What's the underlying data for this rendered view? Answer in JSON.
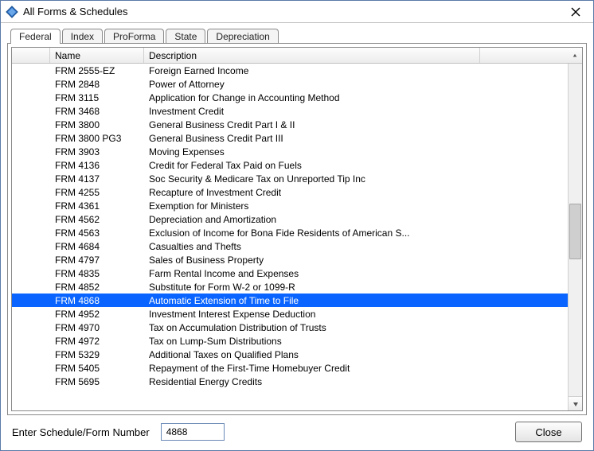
{
  "window": {
    "title": "All Forms & Schedules"
  },
  "tabs": [
    {
      "label": "Federal",
      "active": true
    },
    {
      "label": "Index",
      "active": false
    },
    {
      "label": "ProForma",
      "active": false
    },
    {
      "label": "State",
      "active": false
    },
    {
      "label": "Depreciation",
      "active": false
    }
  ],
  "columns": {
    "name": "Name",
    "description": "Description"
  },
  "rows": [
    {
      "name": "FRM 2555-EZ",
      "description": "Foreign Earned Income",
      "selected": false
    },
    {
      "name": "FRM 2848",
      "description": "Power of Attorney",
      "selected": false
    },
    {
      "name": "FRM 3115",
      "description": "Application for Change in Accounting Method",
      "selected": false
    },
    {
      "name": "FRM 3468",
      "description": "Investment Credit",
      "selected": false
    },
    {
      "name": "FRM 3800",
      "description": "General Business Credit Part I & II",
      "selected": false
    },
    {
      "name": "FRM 3800 PG3",
      "description": "General Business Credit Part III",
      "selected": false
    },
    {
      "name": "FRM 3903",
      "description": "Moving Expenses",
      "selected": false
    },
    {
      "name": "FRM 4136",
      "description": "Credit for Federal Tax Paid on Fuels",
      "selected": false
    },
    {
      "name": "FRM 4137",
      "description": "Soc Security & Medicare Tax on Unreported Tip Inc",
      "selected": false
    },
    {
      "name": "FRM 4255",
      "description": "Recapture of Investment Credit",
      "selected": false
    },
    {
      "name": "FRM 4361",
      "description": "Exemption for Ministers",
      "selected": false
    },
    {
      "name": "FRM 4562",
      "description": "Depreciation and Amortization",
      "selected": false
    },
    {
      "name": "FRM 4563",
      "description": "Exclusion of Income for Bona Fide Residents of American S...",
      "selected": false
    },
    {
      "name": "FRM 4684",
      "description": "Casualties and Thefts",
      "selected": false
    },
    {
      "name": "FRM 4797",
      "description": "Sales of Business Property",
      "selected": false
    },
    {
      "name": "FRM 4835",
      "description": "Farm Rental Income and Expenses",
      "selected": false
    },
    {
      "name": "FRM 4852",
      "description": "Substitute for Form W-2 or 1099-R",
      "selected": false
    },
    {
      "name": "FRM 4868",
      "description": "Automatic Extension of Time to File",
      "selected": true
    },
    {
      "name": "FRM 4952",
      "description": "Investment Interest Expense Deduction",
      "selected": false
    },
    {
      "name": "FRM 4970",
      "description": "Tax on Accumulation Distribution of Trusts",
      "selected": false
    },
    {
      "name": "FRM 4972",
      "description": "Tax on Lump-Sum Distributions",
      "selected": false
    },
    {
      "name": "FRM 5329",
      "description": "Additional Taxes on Qualified Plans",
      "selected": false
    },
    {
      "name": "FRM 5405",
      "description": "Repayment of the First-Time Homebuyer Credit",
      "selected": false
    },
    {
      "name": "FRM 5695",
      "description": "Residential Energy Credits",
      "selected": false
    }
  ],
  "footer": {
    "label": "Enter Schedule/Form Number",
    "input_value": "4868",
    "close_label": "Close"
  }
}
